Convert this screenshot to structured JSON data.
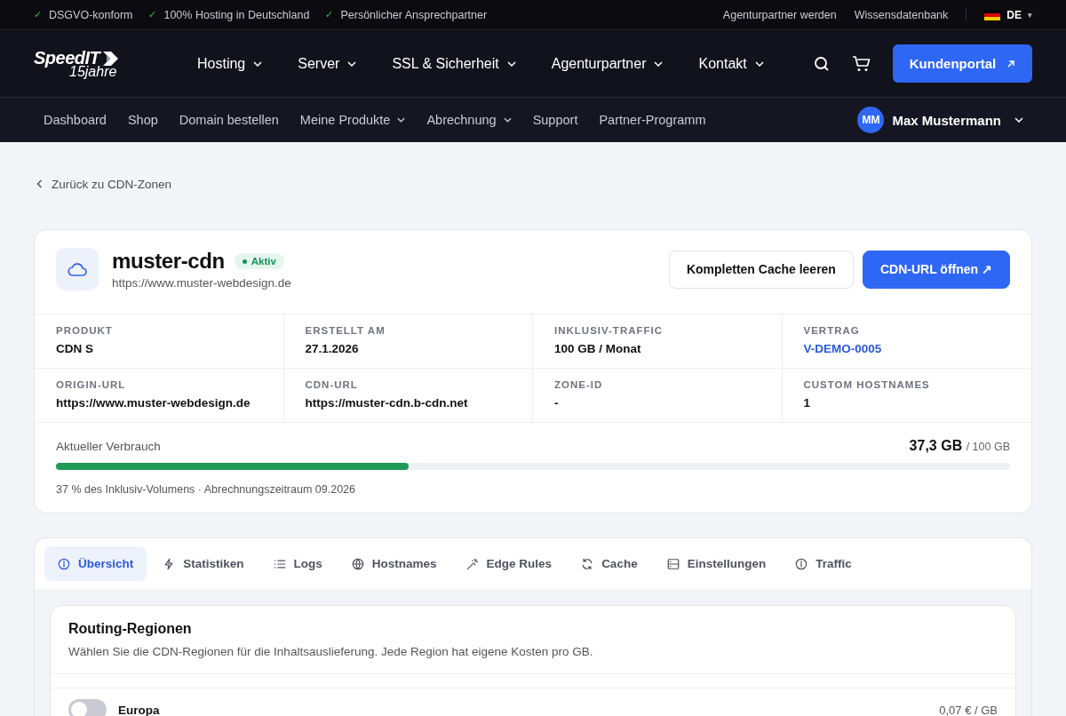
{
  "topbar": {
    "badges": [
      {
        "check": "✓",
        "text": "DSGVO-konform"
      },
      {
        "check": "✓",
        "text": "100% Hosting in Deutschland"
      },
      {
        "check": "✓",
        "text": "Persönlicher Ansprechpartner"
      }
    ],
    "links": [
      "Agenturpartner werden",
      "Wissensdatenbank"
    ],
    "language": {
      "code": "DE",
      "caret": "▾"
    }
  },
  "header": {
    "logo": {
      "name": "SpeedIT",
      "tagline": "15jahre"
    },
    "nav": [
      {
        "label": "Hosting",
        "dropdown": true
      },
      {
        "label": "Server",
        "dropdown": true
      },
      {
        "label": "SSL & Sicherheit",
        "dropdown": true
      },
      {
        "label": "Agenturpartner",
        "dropdown": true
      },
      {
        "label": "Kontakt",
        "dropdown": true
      }
    ],
    "portal_button": "Kundenportal"
  },
  "subnav": {
    "items": [
      {
        "label": "Dashboard",
        "dropdown": false
      },
      {
        "label": "Shop",
        "dropdown": false
      },
      {
        "label": "Domain bestellen",
        "dropdown": false
      },
      {
        "label": "Meine Produkte",
        "dropdown": true
      },
      {
        "label": "Abrechnung",
        "dropdown": true
      },
      {
        "label": "Support",
        "dropdown": false
      },
      {
        "label": "Partner-Programm",
        "dropdown": false
      }
    ],
    "user": {
      "initials": "MM",
      "name": "Max Mustermann"
    }
  },
  "back_link": "Zurück zu CDN-Zonen",
  "zone": {
    "name": "muster-cdn",
    "status": "Aktiv",
    "active": true,
    "origin": "https://www.muster-webdesign.de",
    "buttons": [
      {
        "label": "Kompletten Cache leeren",
        "kind": "secondary"
      },
      {
        "label": "CDN-URL öffnen ↗",
        "kind": "primary"
      }
    ],
    "details": [
      {
        "label": "PRODUKT",
        "value": "CDN S",
        "kind": "text"
      },
      {
        "label": "ERSTELLT AM",
        "value": "27.1.2026",
        "kind": "text"
      },
      {
        "label": "INKLUSIV-TRAFFIC",
        "value": "100 GB / Monat",
        "kind": "text"
      },
      {
        "label": "VERTRAG",
        "value": "V-DEMO-0005",
        "kind": "link"
      },
      {
        "label": "ORIGIN-URL",
        "value": "https://www.muster-webdesign.de",
        "kind": "text"
      },
      {
        "label": "CDN-URL",
        "value": "https://muster-cdn.b-cdn.net",
        "kind": "text"
      },
      {
        "label": "ZONE-ID",
        "value": "-",
        "kind": "text"
      },
      {
        "label": "CUSTOM HOSTNAMES",
        "value": "1",
        "kind": "text"
      }
    ],
    "usage": {
      "label": "Aktueller Verbrauch",
      "used": "37,3 GB",
      "total": "/ 100 GB",
      "level": 0.37,
      "note": "37 % des Inklusiv-Volumens · Abrechnungszeitraum 09.2026"
    }
  },
  "tabs": [
    {
      "label": "Übersicht",
      "kind": "info",
      "selected": true
    },
    {
      "label": "Statistiken",
      "kind": "bolt",
      "selected": false
    },
    {
      "label": "Logs",
      "kind": "list",
      "selected": false
    },
    {
      "label": "Hostnames",
      "kind": "globe",
      "selected": false
    },
    {
      "label": "Edge Rules",
      "kind": "wand",
      "selected": false
    },
    {
      "label": "Cache",
      "kind": "refresh",
      "selected": false
    },
    {
      "label": "Einstellungen",
      "kind": "server",
      "selected": false
    },
    {
      "label": "Traffic",
      "kind": "info",
      "selected": false
    }
  ],
  "routing": {
    "title": "Routing-Regionen",
    "description": "Wählen Sie die CDN-Regionen für die Inhaltsauslieferung. Jede Region hat eigene Kosten pro GB.",
    "regions": [
      {
        "name": "Europa",
        "price": "0,07 € / GB",
        "on": false
      }
    ]
  }
}
